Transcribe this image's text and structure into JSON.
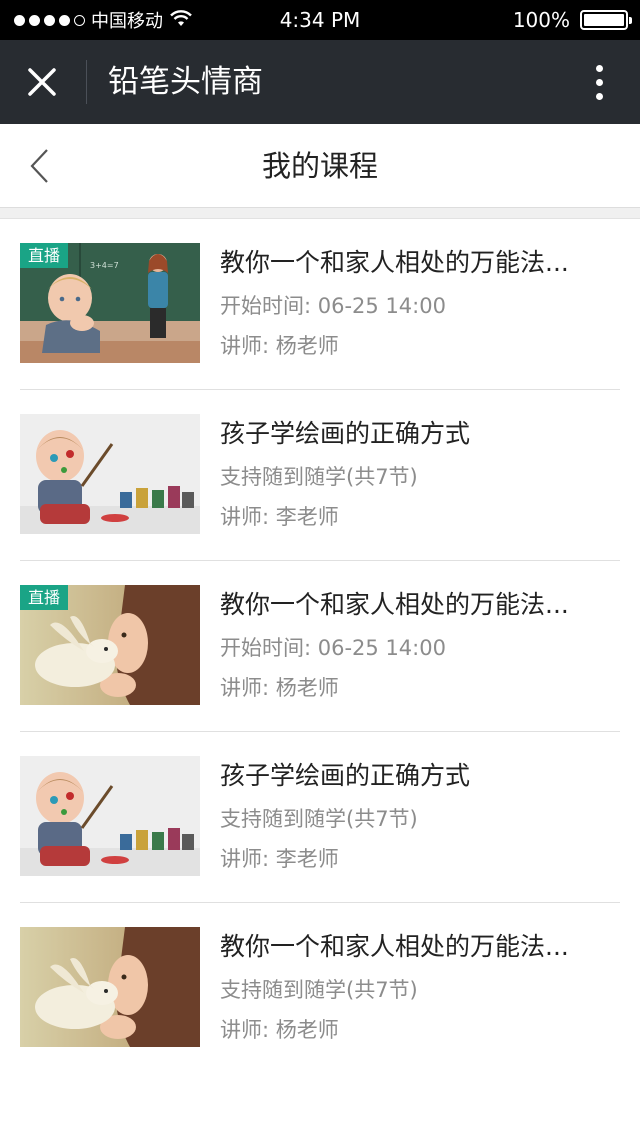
{
  "status_bar": {
    "carrier": "中国移动",
    "time": "4:34 PM",
    "battery": "100%",
    "signal_bars_filled": 4,
    "signal_bars_total": 5
  },
  "nav": {
    "title": "铅笔头情商"
  },
  "header": {
    "title": "我的课程"
  },
  "colors": {
    "live_badge": "#1aa486",
    "nav_bg": "#282c31"
  },
  "courses": [
    {
      "title": "教你一个和家人相处的万能法...",
      "meta": "开始时间: 06-25 14:00",
      "teacher": "讲师: 杨老师",
      "badge": "直播",
      "image": "classroom-boy-photo"
    },
    {
      "title": "孩子学绘画的正确方式",
      "meta": "支持随到随学(共7节)",
      "teacher": "讲师: 李老师",
      "image": "baby-painting-photo"
    },
    {
      "title": "教你一个和家人相处的万能法...",
      "meta": "开始时间: 06-25 14:00",
      "teacher": "讲师: 杨老师",
      "badge": "直播",
      "image": "girl-rabbit-photo"
    },
    {
      "title": "孩子学绘画的正确方式",
      "meta": "支持随到随学(共7节)",
      "teacher": "讲师: 李老师",
      "image": "baby-painting-photo"
    },
    {
      "title": "教你一个和家人相处的万能法...",
      "meta": "支持随到随学(共7节)",
      "teacher": "讲师: 杨老师",
      "image": "girl-rabbit-photo"
    }
  ]
}
